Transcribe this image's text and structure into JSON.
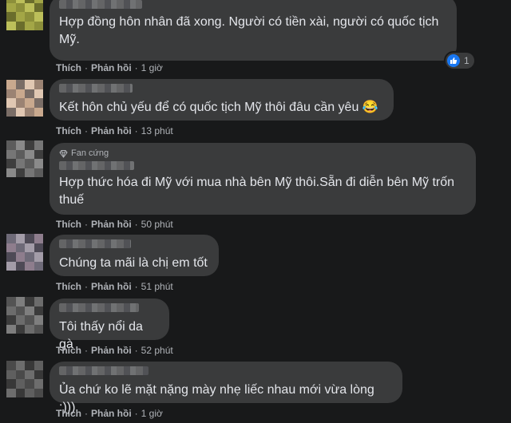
{
  "comments": [
    {
      "text": "Hợp đồng hôn nhân đã xong. Người có tiền xài, người có quốc tịch Mỹ.",
      "like_label": "Thích",
      "reply_label": "Phản hồi",
      "time": "1 giờ",
      "reaction_count": "1",
      "avatar": [
        "#8c8f3a",
        "#a3a646",
        "#6a6d2c",
        "#bcbf5a"
      ]
    },
    {
      "text": "Kết hôn chủ yếu để có quốc tịch Mỹ thôi đâu cần yêu 😂",
      "like_label": "Thích",
      "reply_label": "Phản hồi",
      "time": "13 phút",
      "avatar": [
        "#c9a98e",
        "#9b8373",
        "#e0c7b2",
        "#7a6d66"
      ]
    },
    {
      "badge": "Fan cứng",
      "text": "Hợp thức hóa đi Mỹ với mua nhà bên Mỹ thôi.Sẵn đi diễn bên Mỹ trốn thuế",
      "like_label": "Thích",
      "reply_label": "Phản hồi",
      "time": "50 phút",
      "avatar": [
        "#5c5c5c",
        "#767676",
        "#3e3e3e",
        "#8a8a8a"
      ]
    },
    {
      "text": "Chúng ta mãi là chị em tốt",
      "like_label": "Thích",
      "reply_label": "Phản hồi",
      "time": "51 phút",
      "avatar": [
        "#6e6a78",
        "#8e7d8d",
        "#4e4a56",
        "#a39ca8"
      ]
    },
    {
      "text": "Tôi thấy nổi da gà",
      "like_label": "Thích",
      "reply_label": "Phản hồi",
      "time": "52 phút",
      "avatar": [
        "#535353",
        "#6c6c6c",
        "#3b3b3b",
        "#7e7e7e"
      ]
    },
    {
      "text": "Ủa chứ ko lẽ mặt nặng mày nhẹ liếc nhau mới vừa lòng :)))",
      "like_label": "Thích",
      "reply_label": "Phản hồi",
      "time": "1 giờ",
      "avatar": [
        "#4a4a4a",
        "#5f5f5f",
        "#383838",
        "#6d6d6d"
      ]
    }
  ],
  "colors": {
    "background": "#18191a",
    "bubble": "#3a3b3c",
    "text": "#e4e6eb",
    "secondary": "#b0b3b8",
    "like_blue": "#1877f2"
  },
  "icons": {
    "badge": "gem-icon",
    "reaction": "like-thumb-icon"
  }
}
